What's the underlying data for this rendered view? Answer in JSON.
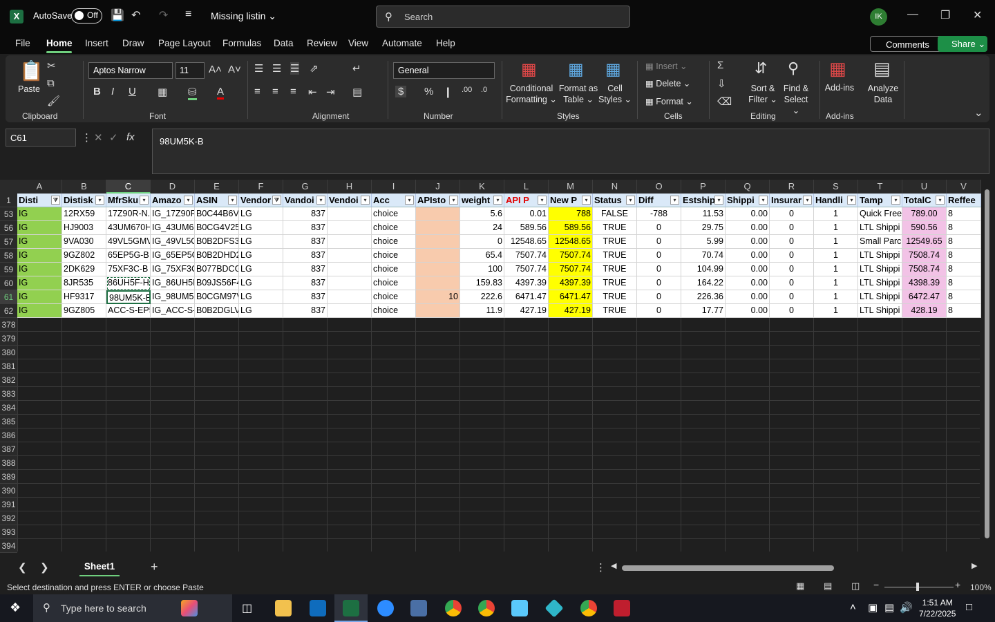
{
  "titlebar": {
    "app_letter": "X",
    "autosave_label": "AutoSave",
    "autosave_state": "Off",
    "doc_title": "Missing listin",
    "search_placeholder": "Search",
    "avatar_initials": "IK"
  },
  "menu": {
    "tabs": [
      "File",
      "Home",
      "Insert",
      "Draw",
      "Page Layout",
      "Formulas",
      "Data",
      "Review",
      "View",
      "Automate",
      "Help"
    ],
    "active": "Home",
    "comments_label": "Comments",
    "share_label": "Share"
  },
  "ribbon": {
    "paste_label": "Paste",
    "groups": [
      "Clipboard",
      "Font",
      "Alignment",
      "Number",
      "Styles",
      "Cells",
      "Editing",
      "Add-ins"
    ],
    "font_name": "Aptos Narrow",
    "font_size": "11",
    "number_format": "General",
    "conditional": "Conditional",
    "formatting": "Formatting",
    "format_as": "Format as",
    "table": "Table",
    "cell": "Cell",
    "styles": "Styles",
    "insert": "Insert",
    "delete": "Delete",
    "format": "Format",
    "sort": "Sort &",
    "filter": "Filter",
    "find": "Find &",
    "select": "Select",
    "addins": "Add-ins",
    "analyze": "Analyze",
    "data": "Data"
  },
  "formula_bar": {
    "name_box": "C61",
    "value": "98UM5K-B"
  },
  "columns": [
    "A",
    "B",
    "C",
    "D",
    "E",
    "F",
    "G",
    "H",
    "I",
    "J",
    "K",
    "L",
    "M",
    "N",
    "O",
    "P",
    "Q",
    "R",
    "S",
    "T",
    "U",
    "V"
  ],
  "selected_column": "C",
  "headers": [
    "Disti",
    "Distisk",
    "MfrSku",
    "Amazo",
    "ASIN",
    "Vendor",
    "Vandoi",
    "Vendoi",
    "Acc",
    "APIsto",
    "weight",
    "API P",
    "New P",
    "Status",
    "Diff",
    "Estship",
    "Shippi",
    "Insurar",
    "Handli",
    "Tamp",
    "TotalC",
    "Reffee"
  ],
  "rows": [
    {
      "num": "53",
      "cells": [
        "IG",
        "12RX59",
        "17Z90R-N.",
        "IG_17Z90R",
        "B0C44B6V",
        "LG",
        "837",
        "",
        "choice",
        "",
        "5.6",
        "0.01",
        "788",
        "FALSE",
        "-788",
        "11.53",
        "0.00",
        "0",
        "1",
        "Quick Free",
        "789.00",
        "8"
      ]
    },
    {
      "num": "56",
      "cells": [
        "IG",
        "HJ9003",
        "43UM670H",
        "IG_43UM6",
        "B0CG4V25",
        "LG",
        "837",
        "",
        "choice",
        "",
        "24",
        "589.56",
        "589.56",
        "TRUE",
        "0",
        "29.75",
        "0.00",
        "0",
        "1",
        "LTL Shippi",
        "590.56",
        "8"
      ]
    },
    {
      "num": "57",
      "cells": [
        "IG",
        "9VA030",
        "49VL5GMV",
        "IG_49VL5G",
        "B0B2DFS3",
        "LG",
        "837",
        "",
        "choice",
        "",
        "0",
        "12548.65",
        "12548.65",
        "TRUE",
        "0",
        "5.99",
        "0.00",
        "0",
        "1",
        "Small Parc",
        "12549.65",
        "8"
      ]
    },
    {
      "num": "58",
      "cells": [
        "IG",
        "9GZ802",
        "65EP5G-B",
        "IG_65EP5G",
        "B0B2DHD2",
        "LG",
        "837",
        "",
        "choice",
        "",
        "65.4",
        "7507.74",
        "7507.74",
        "TRUE",
        "0",
        "70.74",
        "0.00",
        "0",
        "1",
        "LTL Shippi",
        "7508.74",
        "8"
      ]
    },
    {
      "num": "59",
      "cells": [
        "IG",
        "2DK629",
        "75XF3C-B",
        "IG_75XF3C",
        "B077BDCG",
        "LG",
        "837",
        "",
        "choice",
        "",
        "100",
        "7507.74",
        "7507.74",
        "TRUE",
        "0",
        "104.99",
        "0.00",
        "0",
        "1",
        "LTL Shippi",
        "7508.74",
        "8"
      ]
    },
    {
      "num": "60",
      "cells": [
        "IG",
        "8JR535",
        "86UH5F-H",
        "IG_86UH5I",
        "B09JS56F4",
        "LG",
        "837",
        "",
        "choice",
        "",
        "159.83",
        "4397.39",
        "4397.39",
        "TRUE",
        "0",
        "164.22",
        "0.00",
        "0",
        "1",
        "LTL Shippi",
        "4398.39",
        "8"
      ]
    },
    {
      "num": "61",
      "cells": [
        "IG",
        "HF9317",
        "98UM5K-E",
        "IG_98UM5",
        "B0CGM97V",
        "LG",
        "837",
        "",
        "choice",
        "10",
        "222.6",
        "6471.47",
        "6471.47",
        "TRUE",
        "0",
        "226.36",
        "0.00",
        "0",
        "1",
        "LTL Shippi",
        "6472.47",
        "8"
      ]
    },
    {
      "num": "62",
      "cells": [
        "IG",
        "9GZ805",
        "ACC-S-EP5",
        "IG_ACC-S-",
        "B0B2DGLV",
        "LG",
        "837",
        "",
        "choice",
        "",
        "11.9",
        "427.19",
        "427.19",
        "TRUE",
        "0",
        "17.77",
        "0.00",
        "0",
        "1",
        "LTL Shippi",
        "428.19",
        "8"
      ]
    }
  ],
  "empty_rows": [
    "378",
    "379",
    "380",
    "381",
    "382",
    "383",
    "384",
    "385",
    "386",
    "387",
    "388",
    "389",
    "390",
    "391",
    "392",
    "393",
    "394"
  ],
  "header_row_num": "1",
  "sheet_tab": "Sheet1",
  "status": {
    "message": "Select destination and press ENTER or choose Paste",
    "zoom": "100%"
  },
  "taskbar": {
    "search_placeholder": "Type here to search",
    "time": "1:51 AM",
    "date": "7/22/2025"
  },
  "colors": {
    "green_fill": "#92d050",
    "orange_fill": "#f8cbad",
    "yellow_fill": "#ffff00",
    "pink_fill": "#f2c2e6",
    "header_fill": "#dae9f8",
    "accent": "#6fcf7e"
  }
}
